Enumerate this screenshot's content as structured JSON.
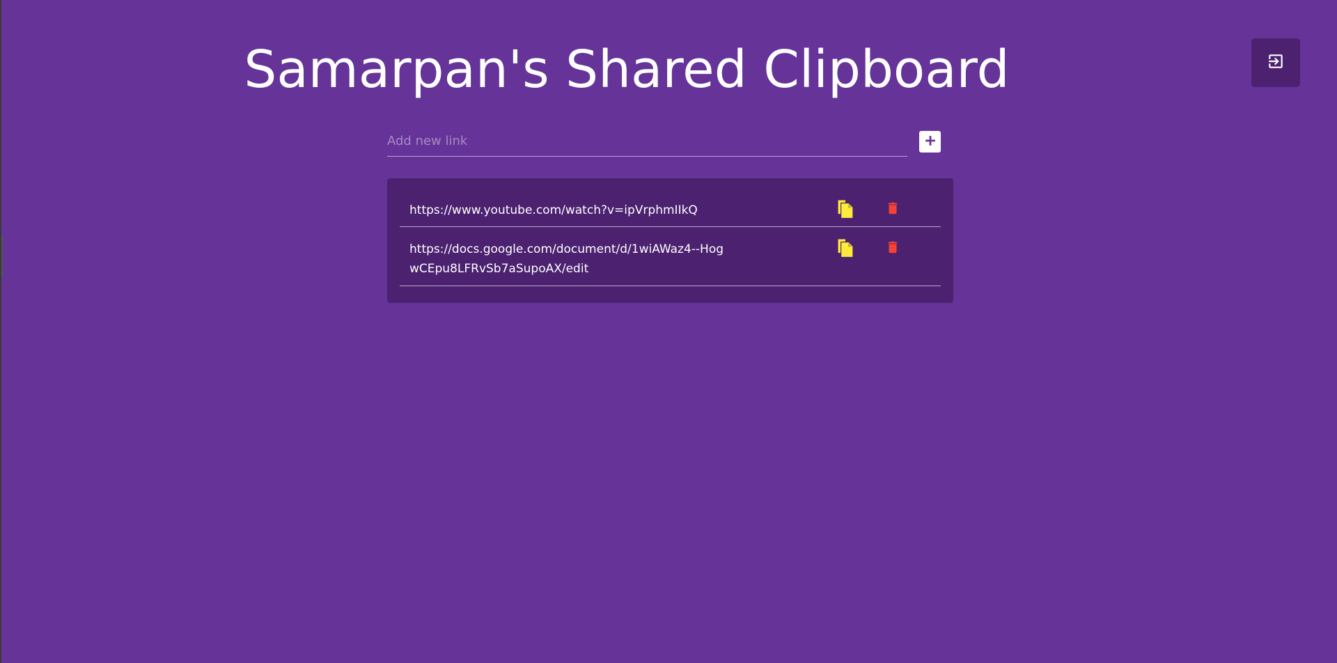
{
  "header": {
    "title": "Samarpan's Shared Clipboard",
    "logout_icon": "logout-icon"
  },
  "add_form": {
    "placeholder": "Add new link",
    "value": "",
    "add_icon": "plus-icon"
  },
  "links": [
    {
      "url": "https://www.youtube.com/watch?v=ipVrphmIIkQ",
      "copy_icon": "copy-icon",
      "delete_icon": "trash-icon"
    },
    {
      "url": "https://docs.google.com/document/d/1wiAWaz4--HogwCEpu8LFRvSb7aSupoAX/edit",
      "copy_icon": "copy-icon",
      "delete_icon": "trash-icon"
    }
  ],
  "colors": {
    "background": "#663399",
    "panel": "#4b2170",
    "copy_icon": "#ffeb3b",
    "delete_icon": "#f44336",
    "accent": "#ffffff"
  }
}
